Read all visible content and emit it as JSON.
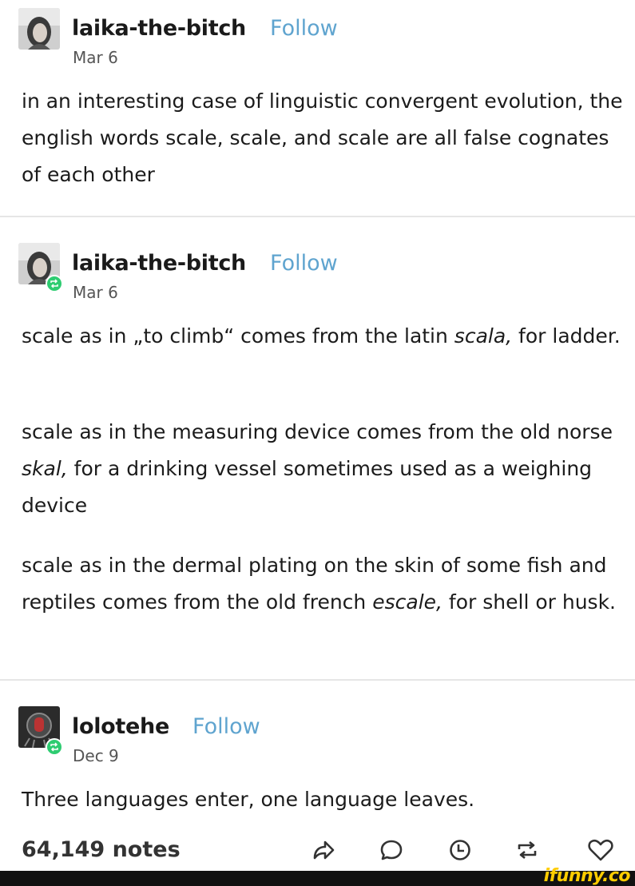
{
  "posts": [
    {
      "username": "laika-the-bitch",
      "follow_label": "Follow",
      "date": "Mar 6",
      "paragraphs": [
        "in an interesting case of linguistic convergent evolution, the english words scale, scale, and scale are all false cognates of each other"
      ]
    },
    {
      "username": "laika-the-bitch",
      "follow_label": "Follow",
      "date": "Mar 6",
      "reblogged": true,
      "paragraphs": [
        {
          "before": "scale as in „to climb“ comes from the latin ",
          "italic": "scala,",
          "after": " for ladder."
        },
        {
          "before": "scale as in the measuring device comes from the old norse ",
          "italic": "skal,",
          "after": " for a drinking vessel sometimes used as a weighing device"
        },
        {
          "before": "scale as in the dermal plating on the skin of some fish and reptiles comes from the old french ",
          "italic": "escale,",
          "after": " for shell or husk."
        }
      ]
    },
    {
      "username": "lolotehe",
      "follow_label": "Follow",
      "date": "Dec 9",
      "reblogged": true,
      "paragraphs": [
        "Three languages enter, one language leaves."
      ]
    }
  ],
  "footer": {
    "notes": "64,149 notes",
    "actions": [
      "share-icon",
      "reply-icon",
      "queue-icon",
      "reblog-icon",
      "like-icon"
    ]
  },
  "watermark": {
    "text": "ifunny.co"
  },
  "colors": {
    "follow": "#5fa4cf",
    "reblog_badge": "#2ecc71",
    "text": "#1b1b1b"
  }
}
